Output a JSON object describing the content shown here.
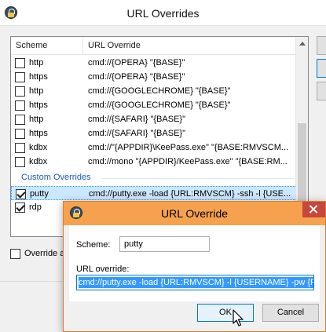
{
  "window": {
    "title": "URL Overrides",
    "icon": "keepass-lock-icon"
  },
  "list": {
    "columns": [
      "Scheme",
      "URL Override"
    ],
    "builtin_rows": [
      {
        "checked": false,
        "scheme": "http",
        "override": "cmd://{OPERA} \"{BASE}\""
      },
      {
        "checked": false,
        "scheme": "https",
        "override": "cmd://{OPERA} \"{BASE}\""
      },
      {
        "checked": false,
        "scheme": "http",
        "override": "cmd://{GOOGLECHROME} \"{BASE}\""
      },
      {
        "checked": false,
        "scheme": "https",
        "override": "cmd://{GOOGLECHROME} \"{BASE}\""
      },
      {
        "checked": false,
        "scheme": "http",
        "override": "cmd://{SAFARI} \"{BASE}\""
      },
      {
        "checked": false,
        "scheme": "https",
        "override": "cmd://{SAFARI} \"{BASE}\""
      },
      {
        "checked": false,
        "scheme": "kdbx",
        "override": "cmd://\"{APPDIR}\\KeePass.exe\" \"{BASE:RMVSCM..."
      },
      {
        "checked": false,
        "scheme": "kdbx",
        "override": "cmd://mono \"{APPDIR}/KeePass.exe\" \"{BASE:RM..."
      }
    ],
    "group_label": "Custom Overrides",
    "custom_rows": [
      {
        "checked": true,
        "scheme": "putty",
        "override": "cmd://putty.exe -load {URL:RMVSCM} -ssh -l {USE..."
      },
      {
        "checked": true,
        "scheme": "rdp",
        "override": ""
      }
    ]
  },
  "override_all": {
    "label": "Override a"
  },
  "dialog": {
    "title": "URL Override",
    "icon": "keepass-lock-icon",
    "scheme_label": "Scheme:",
    "scheme_value": "putty",
    "url_label": "URL override:",
    "url_value": "cmd://putty.exe -load {URL:RMVSCM} -l {USERNAME} -pw {P",
    "ok_label": "OK",
    "cancel_label": "Cancel"
  },
  "colors": {
    "dialog_title": "#f6a14e",
    "close_button": "#c7463d",
    "group_header": "#1e5bbd",
    "selection": "#3399ff"
  }
}
